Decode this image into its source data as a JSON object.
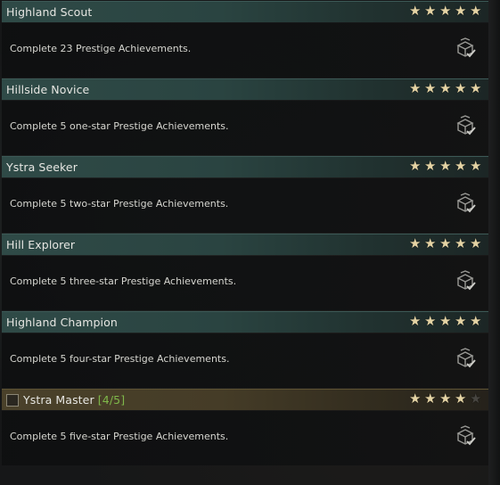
{
  "achievements": [
    {
      "title": "Highland Scout",
      "description": "Complete 23 Prestige Achievements.",
      "stars": 5,
      "max_stars": 5
    },
    {
      "title": "Hillside Novice",
      "description": "Complete 5 one-star Prestige Achievements.",
      "stars": 5,
      "max_stars": 5
    },
    {
      "title": "Ystra Seeker",
      "description": "Complete 5 two-star Prestige Achievements.",
      "stars": 5,
      "max_stars": 5
    },
    {
      "title": "Hill Explorer",
      "description": "Complete 5 three-star Prestige Achievements.",
      "stars": 5,
      "max_stars": 5
    },
    {
      "title": "Highland Champion",
      "description": "Complete 5 four-star Prestige Achievements.",
      "stars": 5,
      "max_stars": 5
    },
    {
      "title": "Ystra Master",
      "progress": "[4/5]",
      "description": "Complete 5 five-star Prestige Achievements.",
      "stars": 4,
      "max_stars": 5
    }
  ],
  "colors": {
    "completed_header": "#2f4a47",
    "in_progress_header": "#4a412a",
    "star_filled": "#e4d3a4",
    "star_empty": "#474540",
    "progress_text": "#7fb84a"
  },
  "icons": {
    "reward": "reward-chest-icon",
    "star": "star-icon"
  }
}
